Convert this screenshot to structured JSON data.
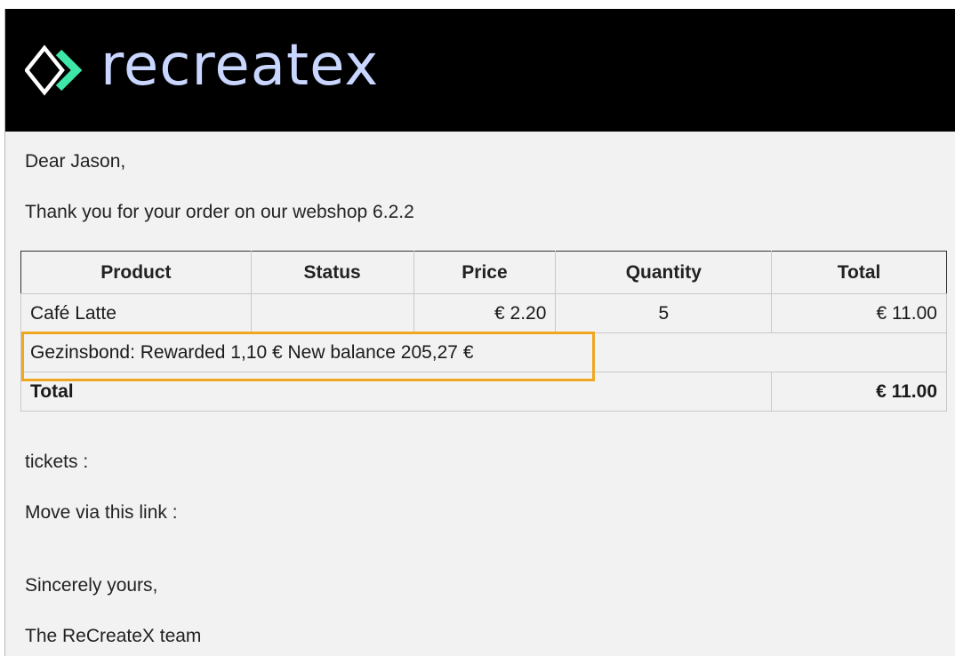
{
  "brand": {
    "name": "recreatex",
    "banner_color": "#000000",
    "logo_colors": {
      "outline": "#ffffff",
      "chevron": "#3ee6a8",
      "text": "#c9d6ff"
    }
  },
  "email": {
    "greeting": "Dear Jason,",
    "intro": "Thank you for your order on our webshop 6.2.2",
    "table": {
      "headers": [
        "Product",
        "Status",
        "Price",
        "Quantity",
        "Total"
      ],
      "rows": [
        {
          "product": "Café Latte",
          "status": "",
          "price": "€ 2.20",
          "quantity": "5",
          "total": "€ 11.00"
        }
      ],
      "reward_note": "Gezinsbond: Rewarded 1,10 € New balance 205,27 €",
      "total_label": "Total",
      "total_value": "€ 11.00"
    },
    "tickets_line": "tickets :",
    "move_line": "Move via this link :",
    "closing": "Sincerely yours,",
    "signature": "The ReCreateX team"
  },
  "highlight": {
    "color": "#f0a720"
  }
}
